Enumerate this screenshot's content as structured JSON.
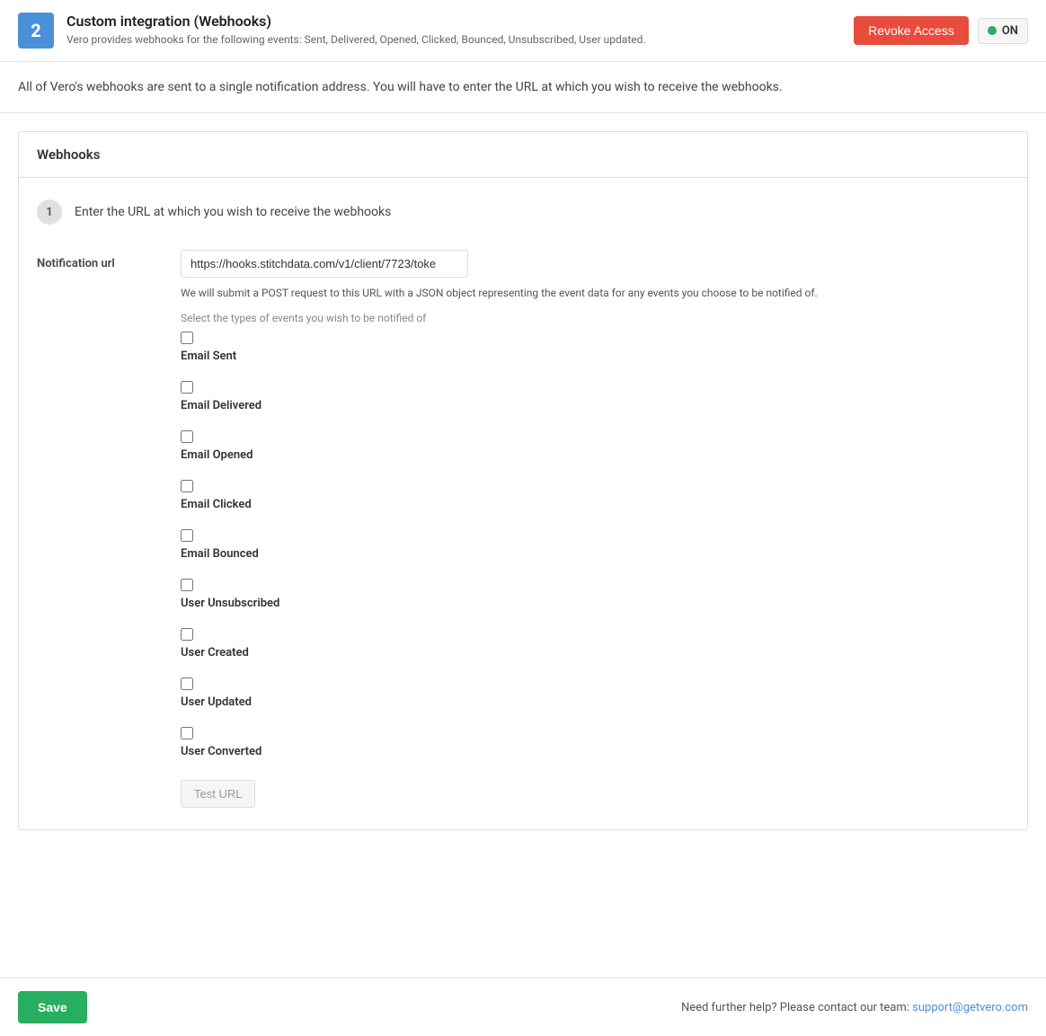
{
  "header": {
    "logo_text": "2",
    "title": "Custom integration (Webhooks)",
    "subtitle": "Vero provides webhooks for the following events: Sent, Delivered, Opened, Clicked, Bounced, Unsubscribed, User updated.",
    "revoke_btn_label": "Revoke Access",
    "toggle_label": "ON"
  },
  "description": {
    "text": "All of Vero's webhooks are sent to a single notification address. You will have to enter the URL at which you wish to receive the webhooks."
  },
  "card": {
    "title": "Webhooks",
    "step": {
      "number": "1",
      "label": "Enter the URL at which you wish to receive the webhooks"
    },
    "form": {
      "label": "Notification url",
      "url_value": "https://hooks.stitchdata.com/v1/client/7723/toke",
      "hint": "We will submit a POST request to this URL with a JSON object representing the event data for any events you choose to be notified of.",
      "select_types_label": "Select the types of events you wish to be notified of",
      "checkboxes": [
        {
          "id": "email_sent",
          "label": "Email Sent",
          "checked": false
        },
        {
          "id": "email_delivered",
          "label": "Email Delivered",
          "checked": false
        },
        {
          "id": "email_opened",
          "label": "Email Opened",
          "checked": false
        },
        {
          "id": "email_clicked",
          "label": "Email Clicked",
          "checked": false
        },
        {
          "id": "email_bounced",
          "label": "Email Bounced",
          "checked": false
        },
        {
          "id": "user_unsubscribed",
          "label": "User Unsubscribed",
          "checked": false
        },
        {
          "id": "user_created",
          "label": "User Created",
          "checked": false
        },
        {
          "id": "user_updated",
          "label": "User Updated",
          "checked": false
        },
        {
          "id": "user_converted",
          "label": "User Converted",
          "checked": false
        }
      ],
      "test_url_btn": "Test URL"
    }
  },
  "footer": {
    "save_btn": "Save",
    "help_text": "Need further help? Please contact our team:",
    "support_email": "support@getvero.com",
    "support_link": "mailto:support@getvero.com"
  }
}
